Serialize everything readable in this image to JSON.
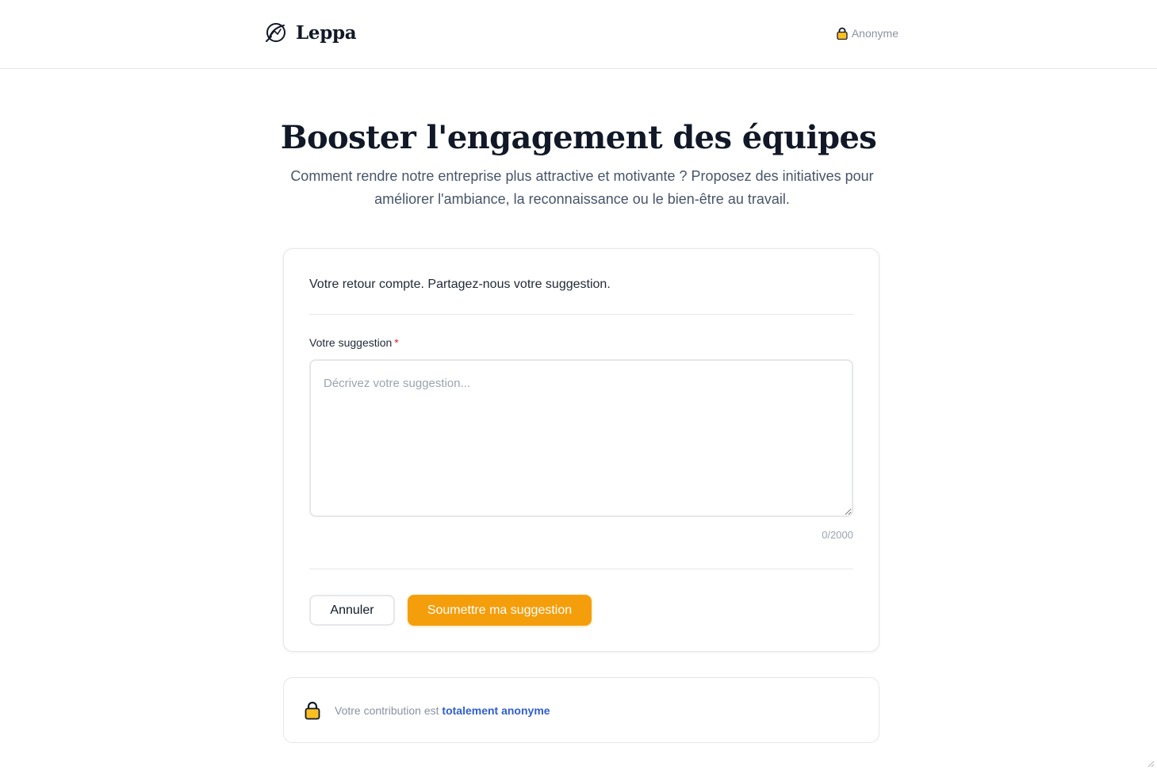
{
  "header": {
    "brand_name": "Leppa",
    "logo_icon": "leppa-logo-icon",
    "user_label": "Anonyme",
    "user_icon": "lock-icon"
  },
  "hero": {
    "title": "Booster l'engagement des équipes",
    "subtitle": "Comment rendre notre entreprise plus attractive et motivante ? Proposez des initiatives pour améliorer l'ambiance, la reconnaissance ou le bien-être au travail."
  },
  "form": {
    "intro": "Votre retour compte. Partagez-nous votre suggestion.",
    "field_label": "Votre suggestion",
    "required_marker": "*",
    "placeholder": "Décrivez votre suggestion...",
    "value": "",
    "char_count": "0/2000",
    "cancel_label": "Annuler",
    "submit_label": "Soumettre ma suggestion"
  },
  "notice": {
    "icon": "lock-icon",
    "text_prefix": "Votre contribution est ",
    "text_emphasis": "totalement anonyme"
  },
  "colors": {
    "accent": "#f59e0b",
    "link": "#2f5fcc",
    "lock_body": "#fbbf24",
    "required": "#dc2626"
  }
}
